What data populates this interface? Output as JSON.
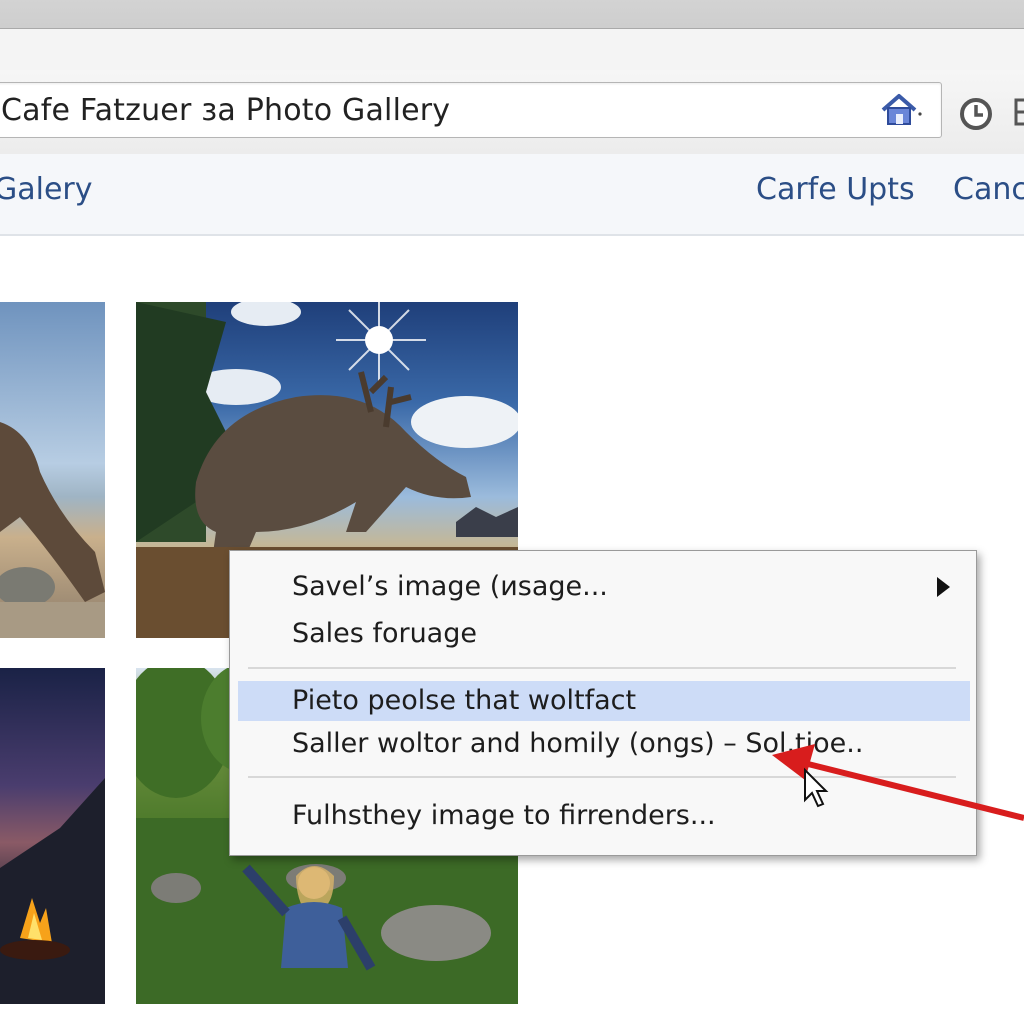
{
  "browser": {
    "address_text": "Cafe Fatzuer за Photo Gallery",
    "home_icon": "home-icon",
    "history_icon": "clock-icon"
  },
  "navbar": {
    "left_link": "Galery",
    "right_links": [
      "Carfe Upts",
      "Canc"
    ]
  },
  "gallery": {
    "photos": [
      {
        "name": "beach-creature-photo"
      },
      {
        "name": "antlered-creature-photo"
      },
      {
        "name": "campfire-mountain-photo"
      },
      {
        "name": "woman-in-garden-photo"
      }
    ]
  },
  "context_menu": {
    "items": [
      {
        "label": "Savel’s image (иsage...",
        "has_submenu": true
      },
      {
        "label": "Sales foruage",
        "has_submenu": false
      },
      {
        "label": "Pieto peolse that woltfact",
        "highlighted": true
      },
      {
        "label": "Saller woltor and homily (ongs) – Sol.tioe..",
        "has_submenu": false
      },
      {
        "label": "Fulhsthey image to firrenders...",
        "has_submenu": false
      }
    ],
    "highlight_color": "#cddcf7"
  },
  "annotation": {
    "arrow_color": "#d81d1d",
    "arrow_icon": "red-arrow-icon",
    "cursor_icon": "mouse-pointer-icon"
  }
}
